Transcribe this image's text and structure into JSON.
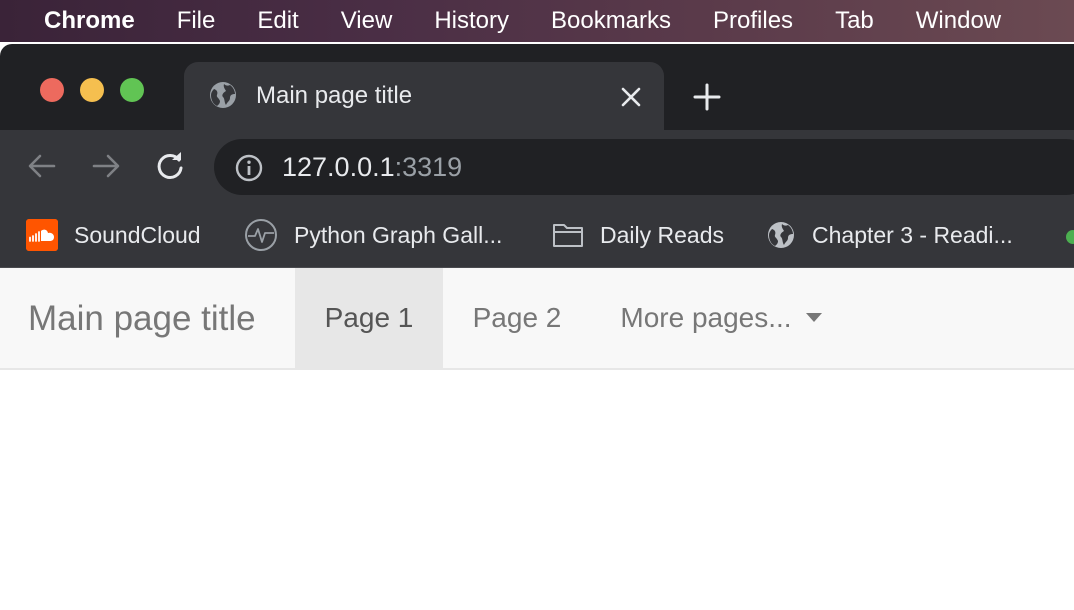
{
  "menubar": {
    "items": [
      "Chrome",
      "File",
      "Edit",
      "View",
      "History",
      "Bookmarks",
      "Profiles",
      "Tab",
      "Window"
    ]
  },
  "browser": {
    "tab": {
      "title": "Main page title",
      "icon": "globe-icon"
    },
    "address": {
      "host": "127.0.0.1",
      "port": ":3319"
    },
    "bookmarks": [
      {
        "label": "SoundCloud",
        "icon": "soundcloud-icon"
      },
      {
        "label": "Python Graph Gall...",
        "icon": "graph-icon"
      },
      {
        "label": "Daily Reads",
        "icon": "folder-icon"
      },
      {
        "label": "Chapter 3 - Readi...",
        "icon": "globe-icon"
      }
    ]
  },
  "page": {
    "brand": "Main page title",
    "nav": {
      "page1": "Page 1",
      "page2": "Page 2",
      "more": "More pages..."
    }
  },
  "colors": {
    "tabstrip": "#202124",
    "toolbar": "#35363a",
    "navbar_bg": "#f8f8f8",
    "active_nav": "#e7e7e7"
  }
}
